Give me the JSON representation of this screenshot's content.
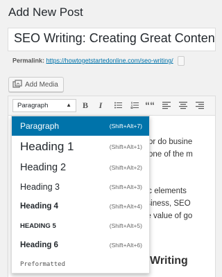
{
  "page": {
    "title": "Add New Post"
  },
  "post": {
    "title_value": "SEO Writing: Creating Great Content"
  },
  "permalink": {
    "label": "Permalink:",
    "url": "https://howtogetstartedonline.com/seo-writing/"
  },
  "buttons": {
    "add_media": "Add Media"
  },
  "toolbar": {
    "format_selected": "Paragraph",
    "bold": "B",
    "italic": "I",
    "quote": "““"
  },
  "format_menu": {
    "items": [
      {
        "label": "Paragraph",
        "shortcut": "(Shift+Alt+7)"
      },
      {
        "label": "Heading 1",
        "shortcut": "(Shift+Alt+1)"
      },
      {
        "label": "Heading 2",
        "shortcut": "(Shift+Alt+2)"
      },
      {
        "label": "Heading 3",
        "shortcut": "(Shift+Alt+3)"
      },
      {
        "label": "Heading 4",
        "shortcut": "(Shift+Alt+4)"
      },
      {
        "label": "HEADING 5",
        "shortcut": "(Shift+Alt+5)"
      },
      {
        "label": "Heading 6",
        "shortcut": "(Shift+Alt+6)"
      },
      {
        "label": "Preformatted",
        "shortcut": ""
      }
    ]
  },
  "content": {
    "line1": "k or do busine",
    "line2": "s one of the m",
    "line3": "sic elements",
    "line4": "usiness, SEO",
    "line5": "he value of go",
    "heading_fragment": "Writing"
  },
  "colors": {
    "accent": "#0073aa",
    "link": "#0073aa"
  }
}
